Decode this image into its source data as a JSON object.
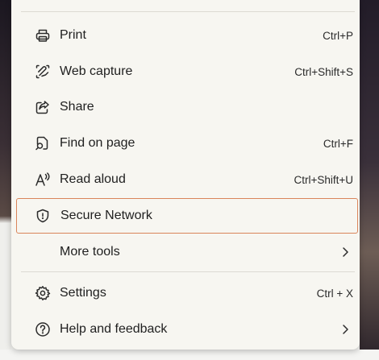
{
  "menu": {
    "items": [
      {
        "label": "Print",
        "shortcut": "Ctrl+P",
        "icon": "printer-icon"
      },
      {
        "label": "Web capture",
        "shortcut": "Ctrl+Shift+S",
        "icon": "web-capture-icon"
      },
      {
        "label": "Share",
        "shortcut": "",
        "icon": "share-icon"
      },
      {
        "label": "Find on page",
        "shortcut": "Ctrl+F",
        "icon": "find-on-page-icon"
      },
      {
        "label": "Read aloud",
        "shortcut": "Ctrl+Shift+U",
        "icon": "read-aloud-icon"
      },
      {
        "label": "Secure Network",
        "shortcut": "",
        "icon": "shield-icon",
        "highlighted": true
      },
      {
        "label": "More tools",
        "shortcut": "",
        "icon": "",
        "submenu": true
      },
      {
        "label": "Settings",
        "shortcut": "Ctrl + X",
        "icon": "gear-icon"
      },
      {
        "label": "Help and feedback",
        "shortcut": "",
        "icon": "help-icon",
        "submenu": true
      }
    ]
  },
  "colors": {
    "menu_background": "#f7f6f1",
    "highlight_border": "#d9845a",
    "divider": "#dcdad3",
    "text": "#1f1f1f"
  }
}
